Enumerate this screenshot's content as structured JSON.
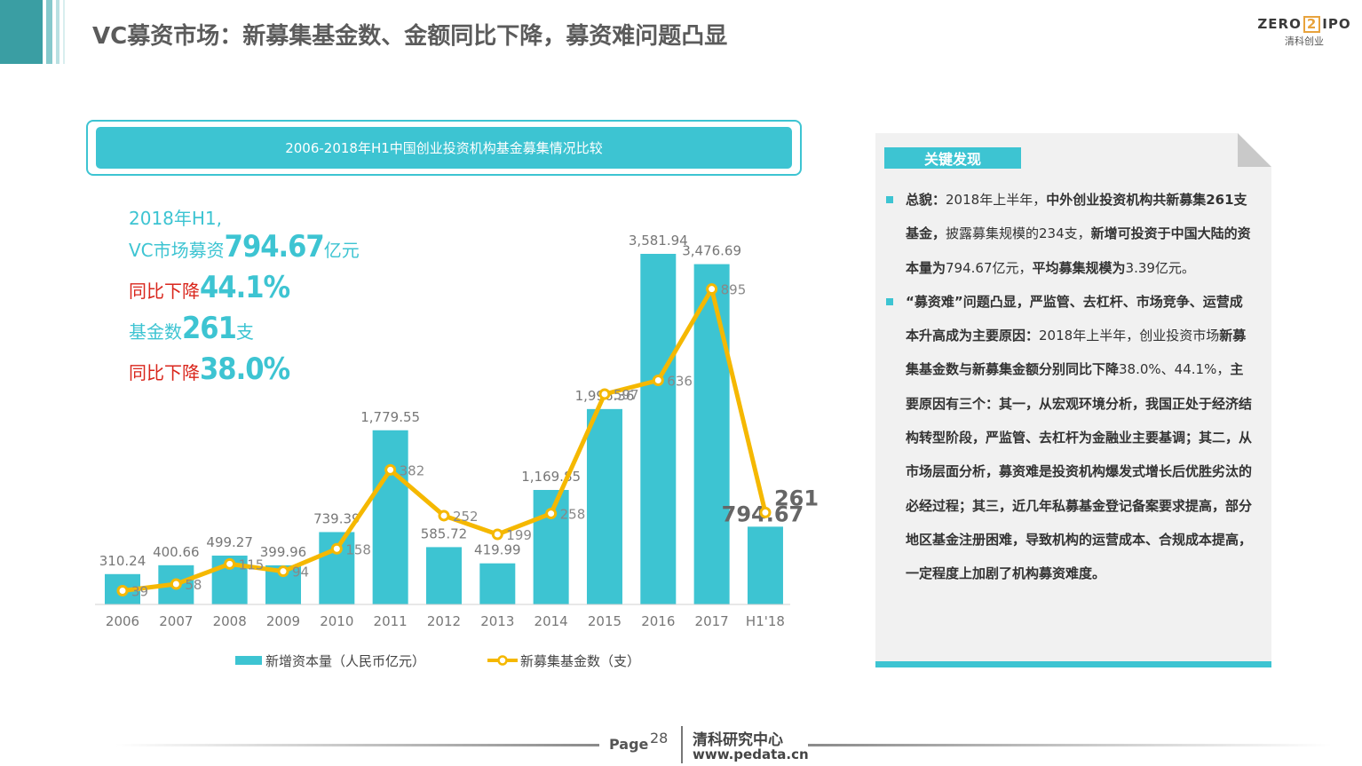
{
  "title": "VC募资市场：新募集基金数、金额同比下降，募资难问题凸显",
  "logo": {
    "brand_left": "ZERO",
    "brand_mid": "2",
    "brand_right": "IPO",
    "sub": "清科创业"
  },
  "chart_header": "2006-2018年H1中国创业投资机构基金募集情况比较",
  "highlights": {
    "line1": "2018年H1,",
    "line2_prefix": "VC市场募资",
    "line2_num": "794.67",
    "line2_suffix": "亿元",
    "line3_prefix": "同比下降",
    "line3_num": "44.1%",
    "line4_prefix": "基金数",
    "line4_num": "261",
    "line4_suffix": "支",
    "line5_prefix": "同比下降",
    "line5_num": "38.0%"
  },
  "colors": {
    "bar": "#3dc4d2",
    "line": "#f5b800",
    "accent_red": "#d9261c"
  },
  "chart_data": {
    "type": "bar",
    "categories": [
      "2006",
      "2007",
      "2008",
      "2009",
      "2010",
      "2011",
      "2012",
      "2013",
      "2014",
      "2015",
      "2016",
      "2017",
      "H1'18"
    ],
    "series": [
      {
        "name": "新增资本量（人民币亿元）",
        "type": "bar",
        "values": [
          310.24,
          400.66,
          499.27,
          399.96,
          739.39,
          1779.55,
          585.72,
          419.99,
          1169.85,
          1996.36,
          3581.94,
          3476.69,
          794.67
        ],
        "labels": [
          "310.24",
          "400.66",
          "499.27",
          "399.96",
          "739.39",
          "1,779.55",
          "585.72",
          "419.99",
          "1,169.85",
          "1,996.36",
          "3,581.94",
          "3,476.69",
          "794.67"
        ]
      },
      {
        "name": "新募集基金数（支）",
        "type": "line",
        "values": [
          39,
          58,
          115,
          94,
          158,
          382,
          252,
          199,
          258,
          597,
          636,
          895,
          261
        ],
        "labels": [
          "39",
          "58",
          "115",
          "94",
          "158",
          "382",
          "252",
          "199",
          "258",
          "597",
          "636",
          "895",
          "261"
        ]
      }
    ],
    "y_left_range": [
      0,
      3600
    ],
    "y_right_range": [
      0,
      1000
    ],
    "legend_position": "bottom"
  },
  "panel": {
    "tab": "关键发现",
    "bullet1": [
      {
        "t": "总貌：",
        "b": true
      },
      {
        "t": "2018年上半年，",
        "b": false
      },
      {
        "t": "中外创业投资机构共新募集261支基金，",
        "b": true
      },
      {
        "t": "披露募集规模的234支，",
        "b": false
      },
      {
        "t": "新增可投资于中国大陆的资本量为",
        "b": true
      },
      {
        "t": "794.67亿元，",
        "b": false
      },
      {
        "t": "平均募集规模为",
        "b": true
      },
      {
        "t": "3.39亿元。",
        "b": false
      }
    ],
    "bullet2": [
      {
        "t": "“募资难”问题凸显，严监管、去杠杆、市场竞争、运营成本升高成为主要原因：",
        "b": true
      },
      {
        "t": "2018年上半年，创业投资市场",
        "b": false
      },
      {
        "t": "新募集基金数与新募集金额分别同比下降",
        "b": true
      },
      {
        "t": "38.0%、44.1%，",
        "b": false
      },
      {
        "t": "主要原因有三个：其一，从宏观环境分析，我国正处于经济结构转型阶段，严监管、去杠杆为金融业主要基调；其二，从市场层面分析，募资难是投资机构爆发式增长后优胜劣汰的必经过程；其三，近几年私募基金登记备案要求提高，部分地区基金注册困难，导致机构的运营成本、合规成本提高，一定程度上加剧了机构募资难度。",
        "b": true
      }
    ]
  },
  "footer": {
    "page_label": "Page",
    "page_num": "28",
    "org": "清科研究中心",
    "url": "www.pedata.cn"
  }
}
